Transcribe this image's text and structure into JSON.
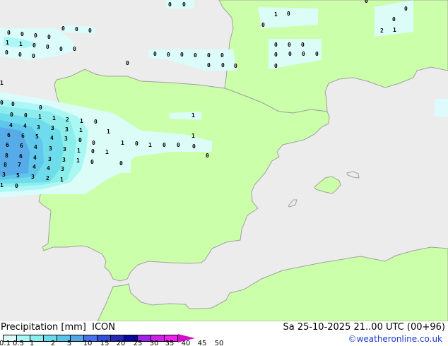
{
  "title": "Precipitation [mm]",
  "model": "ICON",
  "datetime": "Sa 25-10-2025 21..00 UTC (00+96)",
  "copyright": "©weatheronline.co.uk",
  "colors": {
    "land": "#ccffaa",
    "sea": "#ececec",
    "border": "#a0a0a0"
  },
  "legend": {
    "ticks": [
      "0.1",
      "0.5",
      "1",
      "2",
      "5",
      "10",
      "15",
      "20",
      "25",
      "30",
      "35",
      "40",
      "45",
      "50"
    ],
    "colors": [
      "#dcfcfc",
      "#a8f8f8",
      "#88eeee",
      "#68dcec",
      "#58c4ec",
      "#50a8e8",
      "#4870f0",
      "#3050d8",
      "#2828b8",
      "#0808a0",
      "#a020f0",
      "#d020e8",
      "#f020f0",
      "#d010c8"
    ]
  },
  "values": [
    "0",
    "0",
    "0",
    "0",
    "0",
    "0",
    "0",
    "1",
    "1",
    "0",
    "0",
    "0",
    "0",
    "0",
    "0",
    "0",
    "0",
    "0",
    "0",
    "0",
    "0",
    "0",
    "0",
    "0",
    "0",
    "0",
    "0",
    "0",
    "0",
    "0",
    "0",
    "1",
    "0",
    "0",
    "0",
    "0",
    "0",
    "0",
    "0",
    "0",
    "0",
    "0",
    "2",
    "1",
    "1",
    "0",
    "0",
    "0",
    "0",
    "0",
    "1",
    "1",
    "2",
    "1",
    "0",
    "1",
    "4",
    "4",
    "3",
    "3",
    "3",
    "1",
    "6",
    "6",
    "5",
    "4",
    "3",
    "0",
    "0",
    "1",
    "1",
    "0",
    "0",
    "6",
    "6",
    "4",
    "3",
    "3",
    "1",
    "0",
    "1",
    "8",
    "6",
    "4",
    "3",
    "3",
    "1",
    "0",
    "8",
    "7",
    "4",
    "4",
    "3",
    "0",
    "3",
    "5",
    "3",
    "2",
    "1",
    "1",
    "0",
    "1",
    "1",
    "0",
    "0",
    "0",
    "0"
  ]
}
